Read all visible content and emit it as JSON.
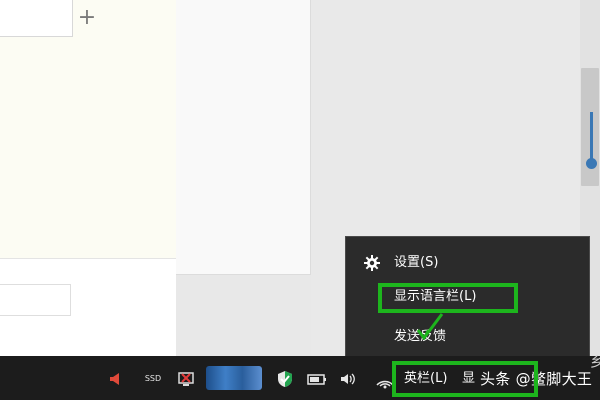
{
  "toolbar": {
    "add_tab_glyph": "+"
  },
  "context_menu": {
    "items": [
      {
        "label": "设置(S)",
        "icon": "gear-icon"
      },
      {
        "label": "显示语言栏(L)"
      },
      {
        "label": "发送反馈"
      }
    ]
  },
  "taskbar": {
    "tray_icons": [
      "megaphone-icon",
      "ssd-icon",
      "network-error-icon",
      "shield-icon",
      "battery-icon",
      "volume-icon",
      "wifi-icon"
    ],
    "ssd_label": "SSD",
    "lang_label": "英栏(L)",
    "lang_label2": "显",
    "watermark": "头条 @鳖脚大王",
    "side_glyph": "乡"
  },
  "annotations": {
    "highlight_color": "#1db51d"
  }
}
